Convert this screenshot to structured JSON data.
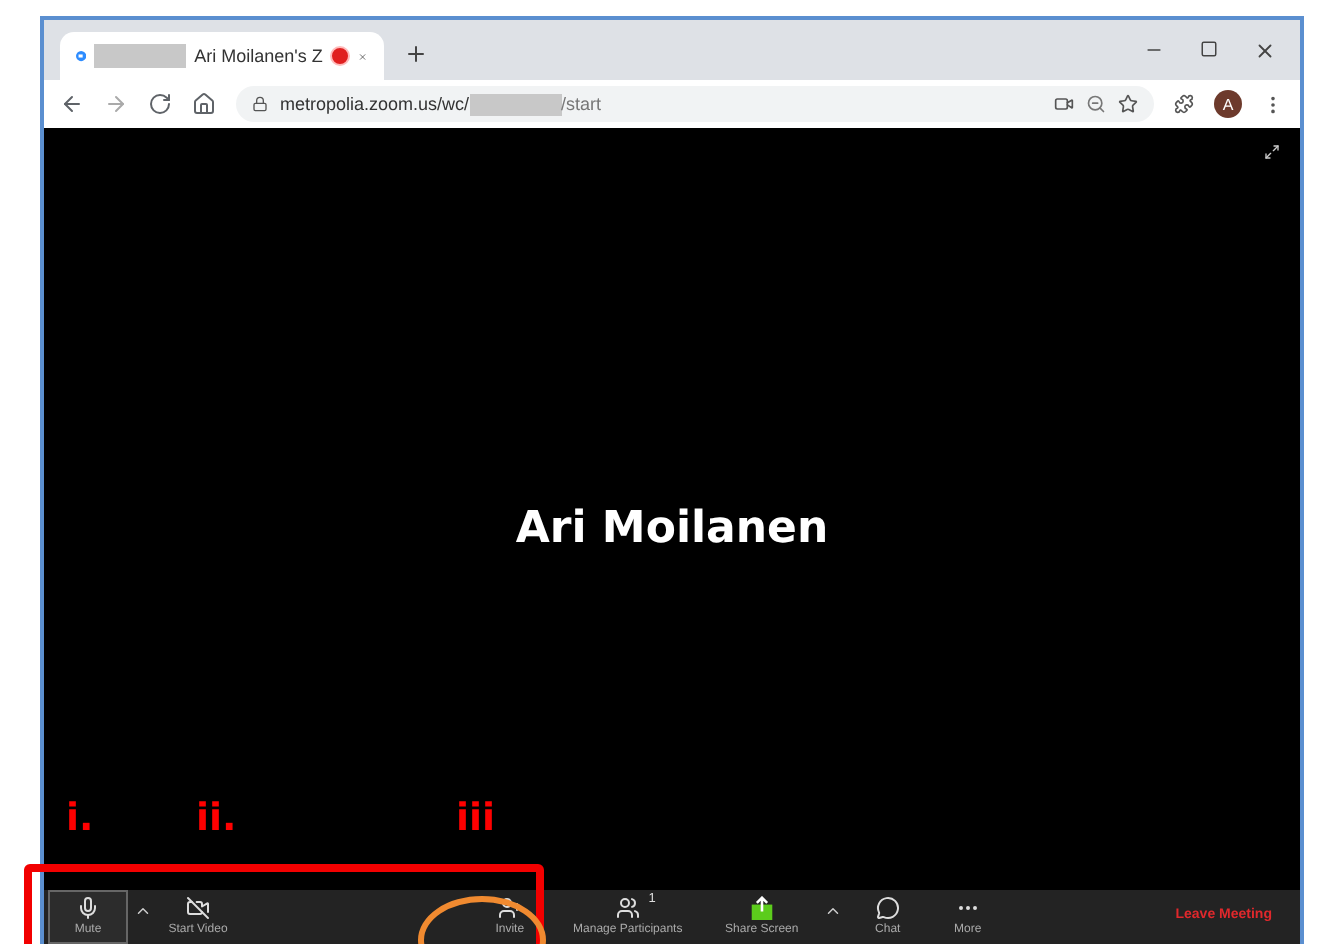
{
  "browser": {
    "tab": {
      "title": "Ari Moilanen's Z",
      "recording": true
    },
    "address": {
      "url_start": "metropolia.zoom.us/wc/",
      "url_end": "/start"
    },
    "profile_initial": "A"
  },
  "meeting": {
    "participant_name": "Ari Moilanen",
    "toolbar": [
      {
        "kind": "mic",
        "label": "Mute",
        "selected": true
      },
      {
        "kind": "caret",
        "selected": false
      },
      {
        "kind": "video",
        "label": "Start Video",
        "selected": false
      },
      {
        "kind": "invite",
        "label": "Invite",
        "selected": false
      },
      {
        "kind": "participants",
        "label": "Manage Participants",
        "badge": "1",
        "selected": false
      },
      {
        "kind": "share",
        "label": "Share Screen",
        "selected": false
      },
      {
        "kind": "caret",
        "selected": false
      },
      {
        "kind": "chat",
        "label": "Chat",
        "selected": false
      },
      {
        "kind": "more",
        "label": "More",
        "selected": false
      }
    ],
    "leave": "Leave Meeting"
  },
  "annotations": [
    {
      "label": "i."
    },
    {
      "label": "ii."
    },
    {
      "label": "iii"
    }
  ]
}
